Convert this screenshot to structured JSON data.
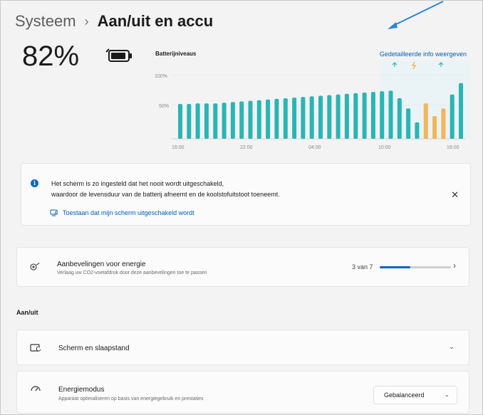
{
  "breadcrumb": {
    "parent": "Systeem",
    "separator": "›",
    "current": "Aan/uit en accu"
  },
  "battery": {
    "percent": "82%"
  },
  "chart_data": {
    "type": "bar",
    "title": "Batterijniveaus",
    "y_ticks": [
      "100%",
      "50%"
    ],
    "x_ticks": [
      "16:00",
      "22:00",
      "04:00",
      "10:00",
      "16:00"
    ],
    "ylim": [
      0,
      100
    ],
    "values": [
      55,
      55,
      56,
      56,
      56,
      57,
      58,
      59,
      60,
      61,
      62,
      63,
      64,
      65,
      66,
      67,
      68,
      69,
      70,
      71,
      72,
      73,
      74,
      75,
      76,
      64,
      48,
      26,
      56,
      36,
      48,
      70,
      88
    ],
    "charging": [
      false,
      false,
      false,
      false,
      false,
      false,
      false,
      false,
      false,
      false,
      false,
      false,
      false,
      false,
      false,
      false,
      false,
      false,
      false,
      false,
      false,
      false,
      false,
      false,
      false,
      false,
      false,
      false,
      true,
      true,
      true,
      false,
      false
    ],
    "colors": {
      "discharge": "#2ab5b4",
      "charging": "#f2b65a"
    }
  },
  "detail_link": "Gedetailleerde info weergeven",
  "info": {
    "line1": "Het scherm is zo ingesteld dat het nooit wordt uitgeschakeld,",
    "line2": "waardoor de levensduur van de batterij afneemt en de koolstofuitstoot toeneemt.",
    "link": "Toestaan dat mijn scherm uitgeschakeld wordt",
    "close": "✕"
  },
  "recommendations": {
    "title": "Aanbevelingen voor energie",
    "subtitle": "Verlaag uw CO2-voetafdruk door deze aanbevelingen toe te passen",
    "count": "3 van 7",
    "progress": 0.43
  },
  "section": {
    "label": "Aan/uit"
  },
  "screen_sleep": {
    "title": "Scherm en slaapstand"
  },
  "energy_mode": {
    "title": "Energiemodus",
    "subtitle": "Apparaat optimaliseren op basis van energiegebruik en prestaties",
    "value": "Gebalanceerd"
  },
  "colors": {
    "accent": "#0067c0",
    "link": "#005fb8",
    "annotation_arrow": "#2a86d6"
  }
}
